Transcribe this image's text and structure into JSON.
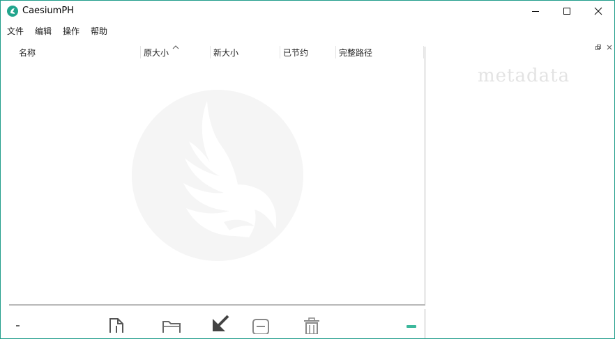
{
  "window": {
    "title": "CaesiumPH",
    "accent_color": "#22a58d",
    "controls": [
      "minimize-icon",
      "maximize-icon",
      "close-icon"
    ]
  },
  "menu": {
    "items": [
      {
        "label": "文件"
      },
      {
        "label": "编辑"
      },
      {
        "label": "操作"
      },
      {
        "label": "帮助"
      }
    ]
  },
  "table": {
    "columns": [
      {
        "label": "名称"
      },
      {
        "label": "原大小"
      },
      {
        "label": "新大小"
      },
      {
        "label": "已节约"
      },
      {
        "label": "完整路径"
      }
    ],
    "sorted_column": "原大小",
    "sort_direction": "ascending",
    "rows": []
  },
  "side_panel": {
    "label": "metadata",
    "dock_icons": [
      "float-icon",
      "close-icon"
    ]
  },
  "toolbar": {
    "icons": [
      "add-file-icon",
      "add-folder-icon",
      "compress-icon",
      "remove-icon",
      "trash-icon"
    ]
  }
}
